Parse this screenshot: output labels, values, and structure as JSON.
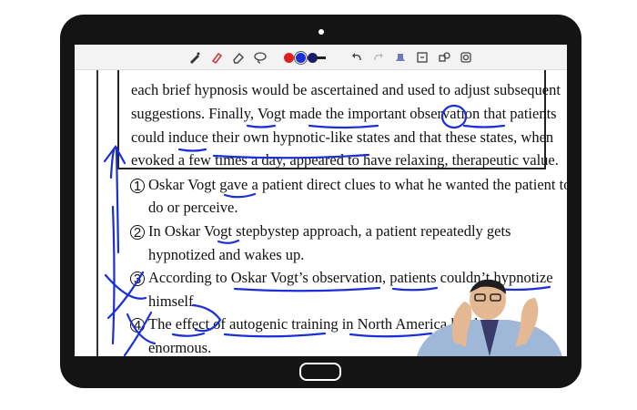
{
  "toolbar": {
    "tools": [
      "pen-icon",
      "highlighter-icon",
      "eraser-icon",
      "lasso-icon"
    ],
    "colors": [
      "#e02020",
      "#1a2fd6",
      "#1a1a6e"
    ],
    "actions": [
      "undo-icon",
      "redo-icon",
      "stamp-icon",
      "fit-icon",
      "shapes-icon",
      "clear-icon"
    ]
  },
  "document": {
    "box_lines": [
      [
        "each brief hypnosis would be ascertained and used to adjust subsequent"
      ],
      [
        "suggestions. Finally, Vogt made the important observation that patients"
      ],
      [
        "could induce their own hypnotic-like states and that these states, when"
      ],
      [
        "evoked a few times a day, appeared to have relaxing, therapeutic value."
      ]
    ],
    "items": [
      {
        "number": "①",
        "line1": "Oskar Vogt gave a patient direct clues to what he wanted the patient to",
        "line2": "do or perceive."
      },
      {
        "number": "②",
        "line1": "In Oskar Vogt stepbystep approach, a patient repeatedly gets",
        "line2": "hypnotized and wakes up."
      },
      {
        "number": "③",
        "line1": "According to Oskar Vogt’s observation, patients couldn’t hypnotize",
        "line2": "himself."
      },
      {
        "number": "④",
        "line1": "The effect of autogenic training in North America has been",
        "line2": "enormous."
      }
    ]
  },
  "ink_color": "#1a2fd6"
}
